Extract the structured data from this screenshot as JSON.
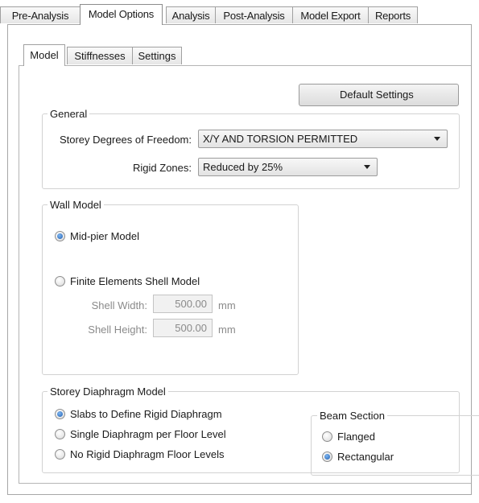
{
  "outer_tabs": [
    "Pre-Analysis",
    "Model Options",
    "Analysis",
    "Post-Analysis",
    "Model Export",
    "Reports"
  ],
  "inner_tabs": [
    "Model",
    "Stiffnesses",
    "Settings"
  ],
  "default_settings_label": "Default Settings",
  "general": {
    "title": "General",
    "storey_dof_label": "Storey Degrees of Freedom:",
    "storey_dof_value": "X/Y AND TORSION PERMITTED",
    "rigid_zones_label": "Rigid Zones:",
    "rigid_zones_value": "Reduced by 25%"
  },
  "wall_model": {
    "title": "Wall Model",
    "options": [
      "Mid-pier Model",
      "Finite Elements Shell Model"
    ],
    "selected": "Mid-pier Model",
    "shell_width_label": "Shell Width:",
    "shell_width_value": "500.00",
    "shell_height_label": "Shell Height:",
    "shell_height_value": "500.00",
    "unit": "mm"
  },
  "storey_diaphragm": {
    "title": "Storey Diaphragm Model",
    "options": [
      "Slabs to Define Rigid Diaphragm",
      "Single Diaphragm per Floor Level",
      "No Rigid Diaphragm Floor Levels"
    ],
    "selected": "Slabs to Define Rigid Diaphragm"
  },
  "beam_section": {
    "title": "Beam Section",
    "options": [
      "Flanged",
      "Rectangular"
    ],
    "selected": "Rectangular"
  }
}
